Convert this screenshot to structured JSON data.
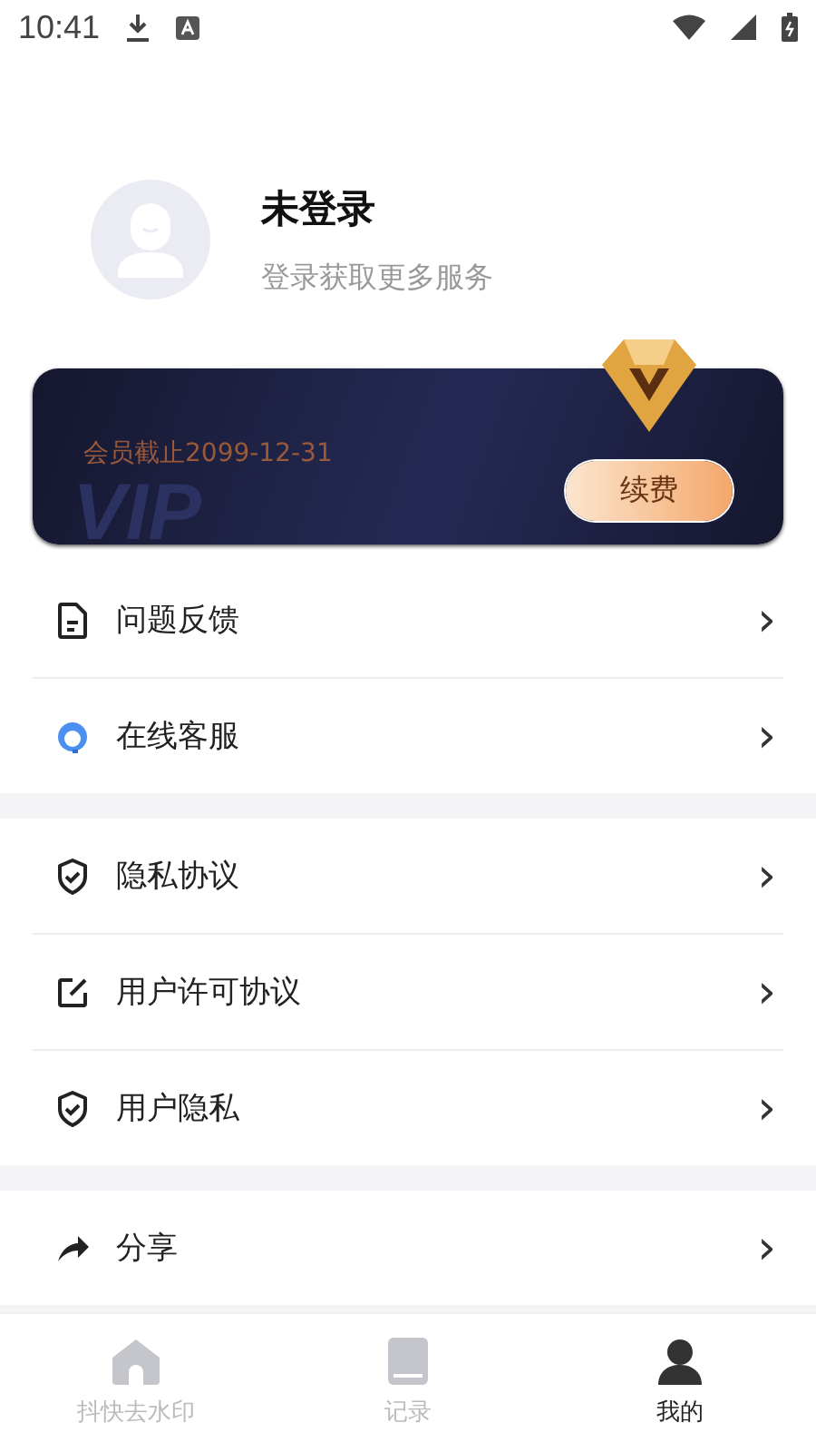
{
  "status_bar": {
    "time": "10:41"
  },
  "profile": {
    "name": "未登录",
    "subtitle": "登录获取更多服务"
  },
  "vip_card": {
    "expiry": "会员截止2099-12-31",
    "watermark": "VIP",
    "renew_button": "续费"
  },
  "menu_groups": [
    {
      "items": [
        {
          "kind": "document",
          "label": "问题反馈",
          "chevron": "›"
        },
        {
          "kind": "support",
          "label": "在线客服",
          "chevron": "›"
        }
      ]
    },
    {
      "items": [
        {
          "kind": "shield",
          "label": "隐私协议",
          "chevron": "›"
        },
        {
          "kind": "edit",
          "label": "用户许可协议",
          "chevron": "›"
        },
        {
          "kind": "shield",
          "label": "用户隐私",
          "chevron": "›"
        }
      ]
    },
    {
      "items": [
        {
          "kind": "share",
          "label": "分享",
          "chevron": "›"
        }
      ]
    }
  ],
  "tab_bar": [
    {
      "kind": "home",
      "label": "抖快去水印",
      "selected": false
    },
    {
      "kind": "record",
      "label": "记录",
      "selected": false
    },
    {
      "kind": "profile",
      "label": "我的",
      "selected": true
    }
  ]
}
